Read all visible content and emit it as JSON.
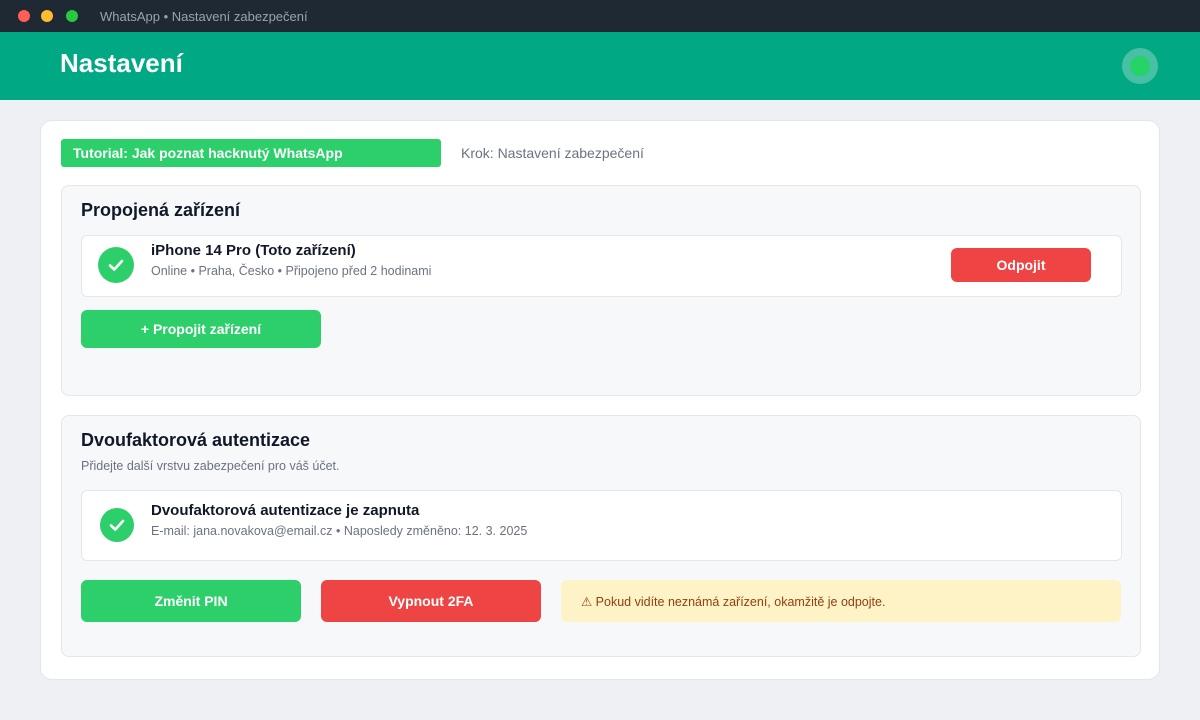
{
  "window": {
    "title": "WhatsApp • Nastavení zabezpečení"
  },
  "header": {
    "title": "Nastavení",
    "avatar_icon": "status-dot-icon"
  },
  "tutorial": {
    "badge": "Tutorial: Jak poznat hacknutý WhatsApp",
    "step": "Krok: Nastavení zabezpečení"
  },
  "linked_devices": {
    "title": "Propojená zařízení",
    "device": {
      "name": "iPhone 14 Pro (Toto zařízení)",
      "details": "Online • Praha, Česko • Připojeno před 2 hodinami",
      "icon": "check-circle-icon",
      "disconnect_label": "Odpojit"
    },
    "link_button_label": "+ Propojit zařízení"
  },
  "two_factor": {
    "title": "Dvoufaktorová autentizace",
    "subtitle": "Přidejte další vrstvu zabezpečení pro váš účet.",
    "status_title": "Dvoufaktorová autentizace je zapnuta",
    "status_details": "E-mail: jana.novakova@email.cz • Naposledy změněno: 12. 3. 2025",
    "status_icon": "check-circle-icon",
    "change_pin_label": "Změnit PIN",
    "disable_label": "Vypnout 2FA",
    "warning": "⚠ Pokud vidíte neznámá zařízení, okamžitě je odpojte."
  },
  "colors": {
    "header": "#00a884",
    "accent_green": "#2dcf6a",
    "danger_red": "#ef4444",
    "warning_bg": "#fef3c7",
    "warning_text": "#92400e"
  }
}
